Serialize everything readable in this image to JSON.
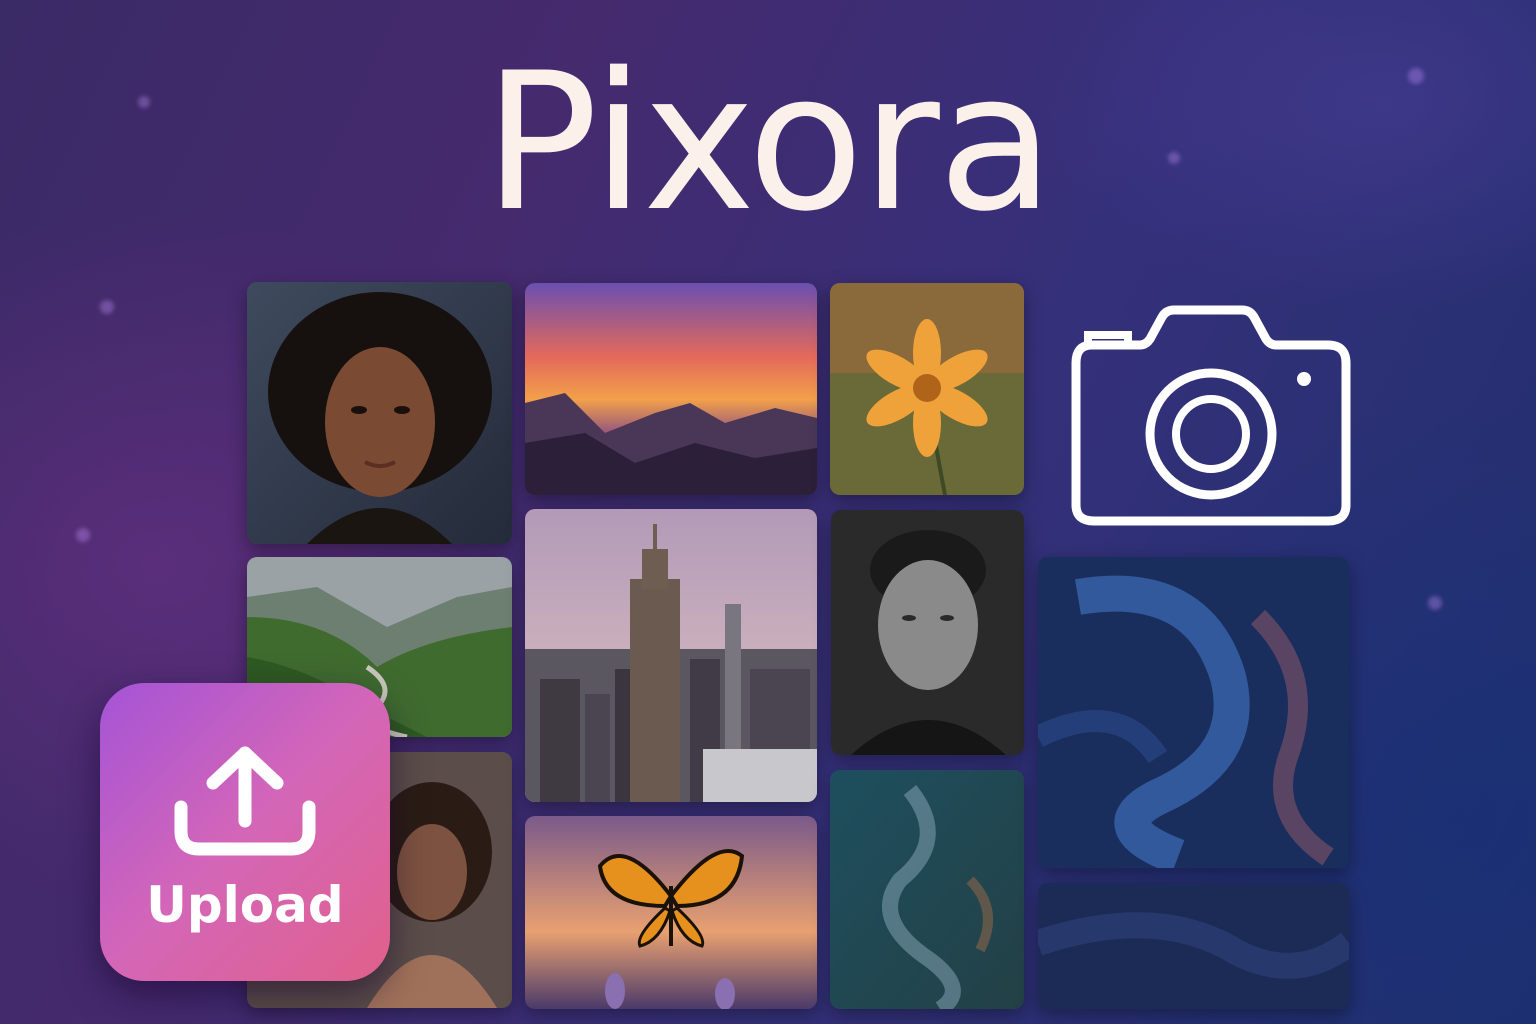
{
  "app": {
    "title": "Pixora"
  },
  "upload": {
    "label": "Upload",
    "icon": "upload-icon"
  },
  "camera": {
    "icon": "camera-icon"
  },
  "colors": {
    "title": "#fbf1ea",
    "upload_gradient_start": "#a454d6",
    "upload_gradient_end": "#e0608a",
    "camera_stroke": "#ffffff"
  },
  "gallery": {
    "photos": [
      {
        "name": "portrait-woman-curly-hair"
      },
      {
        "name": "mountain-sunset"
      },
      {
        "name": "orange-flower"
      },
      {
        "name": "green-valley-road"
      },
      {
        "name": "city-skyline"
      },
      {
        "name": "portrait-man-bw"
      },
      {
        "name": "portrait-woman-2"
      },
      {
        "name": "butterfly-sunset"
      },
      {
        "name": "abstract-teal-swirl"
      },
      {
        "name": "abstract-blue-swirl"
      },
      {
        "name": "abstract-dark-blue"
      }
    ]
  }
}
